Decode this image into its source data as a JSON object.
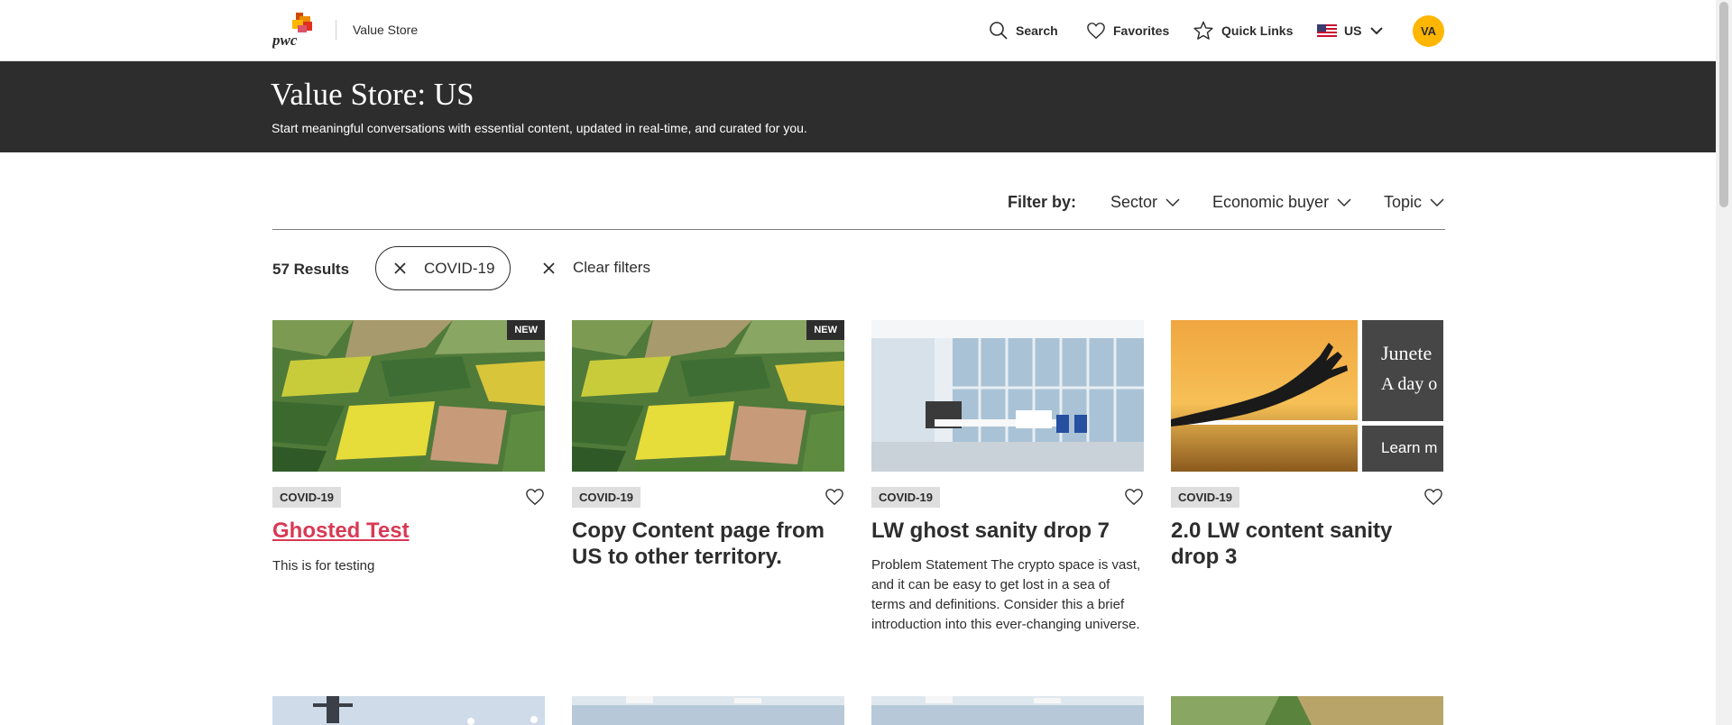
{
  "header": {
    "app_name": "Value Store",
    "nav": {
      "search": "Search",
      "favorites": "Favorites",
      "quick_links": "Quick Links",
      "territory": "US"
    },
    "avatar_initials": "VA"
  },
  "hero": {
    "title": "Value Store: US",
    "subtitle": "Start meaningful conversations with essential content, updated in real-time, and curated for you."
  },
  "filters": {
    "label": "Filter by:",
    "dropdowns": [
      "Sector",
      "Economic buyer",
      "Topic"
    ]
  },
  "results": {
    "count": "57 Results",
    "active_chip": "COVID-19",
    "clear_label": "Clear filters"
  },
  "cards": [
    {
      "badge": "NEW",
      "tag": "COVID-19",
      "title": "Ghosted Test",
      "desc": "This is for testing",
      "image": "aerial-fields"
    },
    {
      "badge": "NEW",
      "tag": "COVID-19",
      "title": "Copy Content page from US to other territory.",
      "desc": "",
      "image": "aerial-fields"
    },
    {
      "badge": "",
      "tag": "COVID-19",
      "title": "LW ghost sanity drop 7",
      "desc": "Problem Statement The crypto space is vast, and it can be easy to get lost in a sea of terms and definitions. Consider this a brief introduction into this ever-changing universe.",
      "image": "office"
    },
    {
      "badge": "",
      "tag": "COVID-19",
      "title": "2.0 LW content sanity drop 3",
      "desc": "",
      "image": "juneteenth",
      "image_text": {
        "line1": "Junete",
        "line2": "A day o",
        "cta": "Learn m"
      }
    }
  ],
  "colors": {
    "brand_orange": "#d04a02",
    "brand_yellow": "#ffb600",
    "brand_red": "#e0301e",
    "hero_bg": "#2d2d2d",
    "link_red": "#d93954",
    "tag_bg": "#dedede"
  }
}
